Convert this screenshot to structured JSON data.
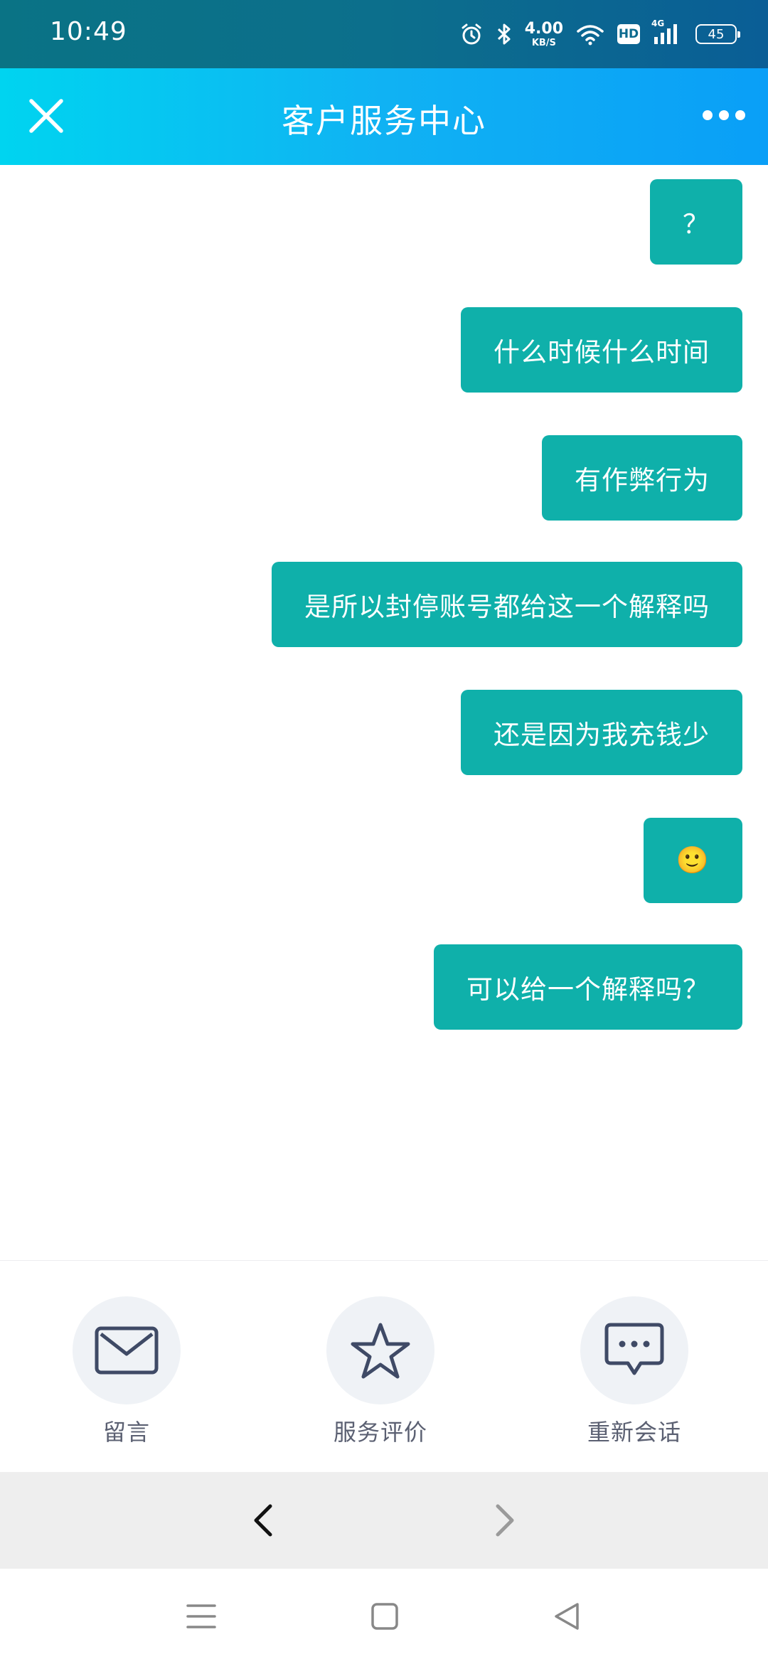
{
  "status_bar": {
    "time": "10:49",
    "net_speed_value": "4.00",
    "net_speed_unit": "KB/S",
    "hd_label": "HD",
    "network_type": "4G",
    "battery_level": "45",
    "icons": [
      "alarm-icon",
      "bluetooth-icon",
      "wifi-icon",
      "signal-icon",
      "battery-icon"
    ]
  },
  "header": {
    "title": "客户服务中心",
    "close_icon": "close-icon",
    "more_icon": "more-icon"
  },
  "chat": {
    "messages": [
      {
        "text": "？",
        "sender": "user"
      },
      {
        "text": "什么时候什么时间",
        "sender": "user"
      },
      {
        "text": "有作弊行为",
        "sender": "user"
      },
      {
        "text": "是所以封停账号都给这一个解释吗",
        "sender": "user"
      },
      {
        "text": "还是因为我充钱少",
        "sender": "user"
      },
      {
        "text": "🙂",
        "sender": "user"
      },
      {
        "text": "可以给一个解释吗？",
        "sender": "user"
      }
    ],
    "bubble_color": "#0fb0aa"
  },
  "actions": [
    {
      "label": "留言",
      "icon": "mail-icon"
    },
    {
      "label": "服务评价",
      "icon": "star-icon"
    },
    {
      "label": "重新会话",
      "icon": "chat-bubble-icon"
    }
  ],
  "browser_nav": {
    "back_icon": "chevron-left-icon",
    "forward_icon": "chevron-right-icon"
  },
  "system_nav": {
    "icons": [
      "menu-icon",
      "home-icon",
      "back-triangle-icon"
    ]
  },
  "colors": {
    "header_gradient_start": "#00d4f0",
    "header_gradient_end": "#0a9ff7",
    "status_bar": "#0c6f8c",
    "action_icon": "#3f4a66"
  }
}
